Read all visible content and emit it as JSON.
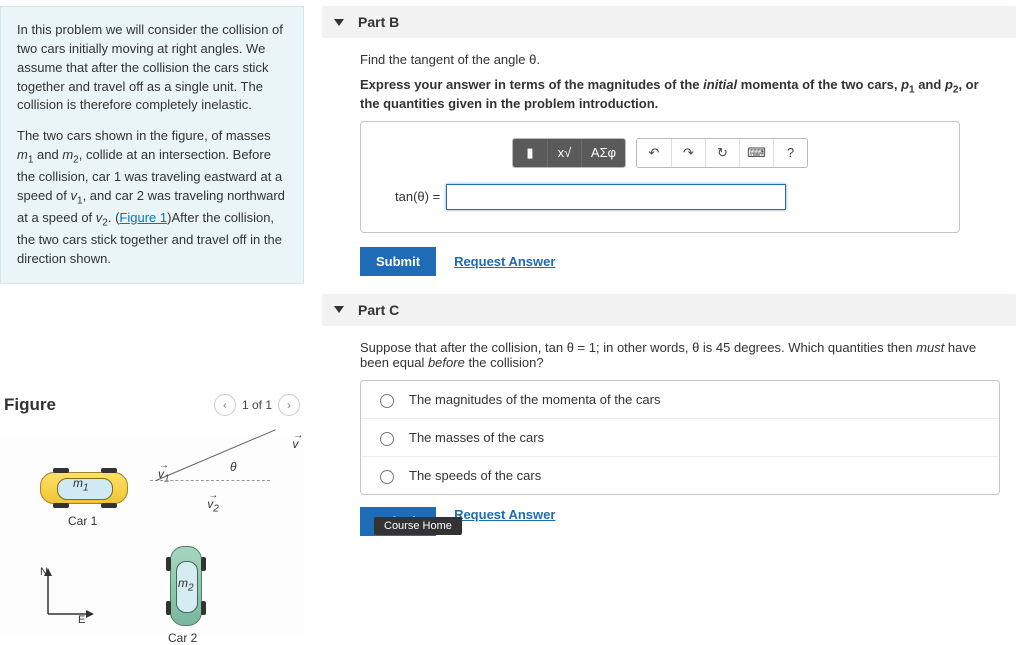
{
  "intro": {
    "para1_a": "In this problem we will consider the collision of two cars initially moving at right angles. We assume that after the collision the cars stick together and travel off as a single unit. The collision is therefore completely inelastic.",
    "para2_a": "The two cars shown in the figure, of masses ",
    "para2_b": " and ",
    "para2_c": ", collide at an intersection. Before the collision, car 1 was traveling eastward at a speed of ",
    "para2_d": ", and car 2 was traveling northward at a speed of ",
    "para2_e": ". (",
    "fig_link": "Figure 1",
    "para2_f": ")After the collision, the two cars stick together and travel off in the direction shown.",
    "m1": "m",
    "m1s": "1",
    "m2": "m",
    "m2s": "2",
    "v1": "v",
    "v1s": "1",
    "v2": "v",
    "v2s": "2"
  },
  "figure": {
    "heading": "Figure",
    "pager": "1 of 1",
    "car1_label": "m",
    "car1_sub": "1",
    "car1_text": "Car 1",
    "car2_label": "m",
    "car2_sub": "2",
    "car2_text": "Car 2",
    "v1": "v",
    "v1s": "1",
    "v2": "v",
    "v2s": "2",
    "v": "v",
    "theta": "θ",
    "N": "N",
    "E": "E"
  },
  "partB": {
    "title": "Part B",
    "prompt": "Find the tangent of the angle θ.",
    "instr_a": "Express your answer in terms of the magnitudes of the ",
    "instr_italic": "initial",
    "instr_b": " momenta of the two cars, ",
    "instr_c": " and ",
    "instr_d": ", or the quantities given in the problem introduction.",
    "p1": "p",
    "p1s": "1",
    "p2": "p",
    "p2s": "2",
    "toolbar": {
      "templates": "▮",
      "root": "x√",
      "greek": "ΑΣφ",
      "undo": "↶",
      "redo": "↷",
      "reset": "↻",
      "keyboard": "⌨",
      "help": "?"
    },
    "lhs": "tan(θ) =",
    "submit": "Submit",
    "request": "Request Answer"
  },
  "partC": {
    "title": "Part C",
    "prompt_a": "Suppose that after the collision, ",
    "prompt_eq": "tan θ = 1",
    "prompt_b": "; in other words, θ is 45 degrees. Which quantities then ",
    "prompt_must": "must",
    "prompt_c": " have been equal ",
    "prompt_before": "before",
    "prompt_d": " the collision?",
    "options": [
      "The magnitudes of the momenta of the cars",
      "The masses of the cars",
      "The speeds of the cars"
    ],
    "submit": "Submit",
    "request": "Request Answer",
    "course_home": "Course Home"
  }
}
